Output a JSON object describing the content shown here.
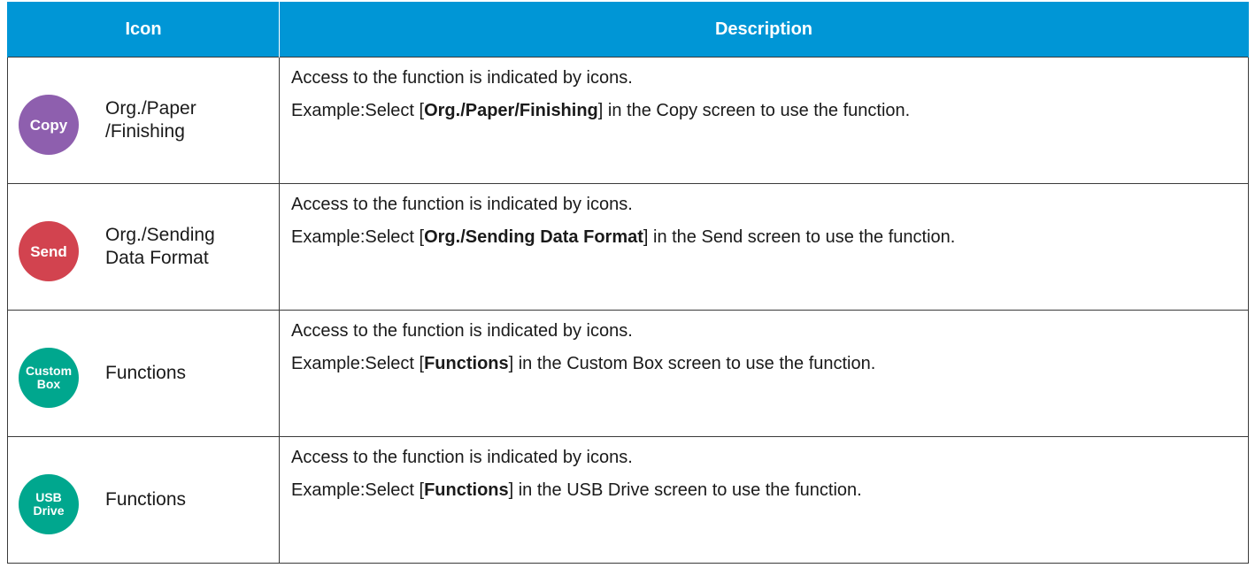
{
  "header": {
    "col_icon": "Icon",
    "col_description": "Description"
  },
  "colors": {
    "header_bg": "#0096d6",
    "copy": "#8e5fae",
    "send": "#d2434f",
    "custom_box": "#00a78e",
    "usb_drive": "#00a78e"
  },
  "rows": [
    {
      "icon_name": "copy-icon",
      "icon_lines": [
        "Copy"
      ],
      "function_lines": [
        "Org./Paper",
        "/Finishing"
      ],
      "access_text": "Access to the function is indicated by icons.",
      "example_label": "Example:",
      "select_prefix": "Select [",
      "function_bold": "Org./Paper/Finishing",
      "select_suffix": "] in the Copy screen to use the function."
    },
    {
      "icon_name": "send-icon",
      "icon_lines": [
        "Send"
      ],
      "function_lines": [
        "Org./Sending",
        "Data Format"
      ],
      "access_text": "Access to the function is indicated by icons.",
      "example_label": "Example:",
      "select_prefix": "Select [",
      "function_bold": "Org./Sending Data Format",
      "select_suffix": "] in the Send screen to use the function."
    },
    {
      "icon_name": "custom-box-icon",
      "icon_lines": [
        "Custom",
        "Box"
      ],
      "function_lines": [
        "Functions"
      ],
      "access_text": "Access to the function is indicated by icons.",
      "example_label": "Example:",
      "select_prefix": "Select [",
      "function_bold": "Functions",
      "select_suffix": "] in the Custom Box screen to use the function."
    },
    {
      "icon_name": "usb-drive-icon",
      "icon_lines": [
        "USB",
        "Drive"
      ],
      "function_lines": [
        "Functions"
      ],
      "access_text": "Access to the function is indicated by icons.",
      "example_label": "Example:",
      "select_prefix": "Select [",
      "function_bold": "Functions",
      "select_suffix": "] in the USB Drive screen to use the function."
    }
  ]
}
